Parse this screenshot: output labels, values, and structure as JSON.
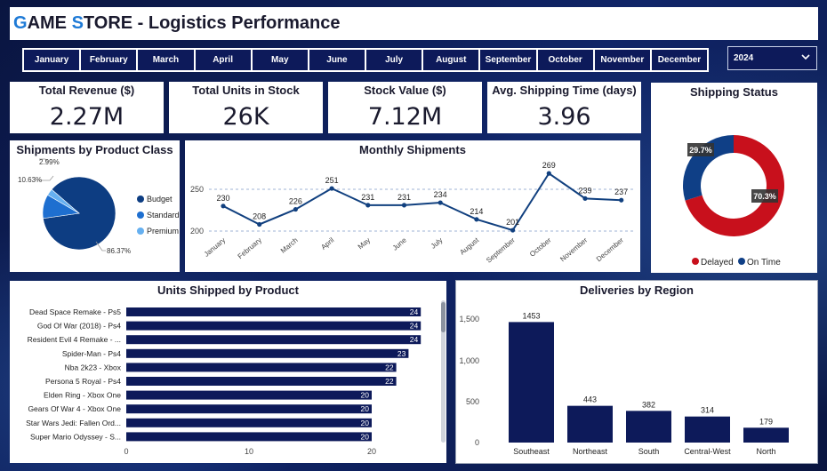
{
  "header": {
    "title_g": "G",
    "title_ame": "AME ",
    "title_s": "S",
    "title_rest": "TORE - Logistics Performance"
  },
  "months": [
    "January",
    "February",
    "March",
    "April",
    "May",
    "June",
    "July",
    "August",
    "September",
    "October",
    "November",
    "December"
  ],
  "year_select": {
    "selected": "2024"
  },
  "kpis": [
    {
      "title": "Total Revenue ($)",
      "value": "2.27M"
    },
    {
      "title": "Total Units in Stock",
      "value": "26K"
    },
    {
      "title": "Stock Value ($)",
      "value": "7.12M"
    },
    {
      "title": "Avg. Shipping Time (days)",
      "value": "3.96"
    }
  ],
  "colors": {
    "navy": "#0d1a5a",
    "budget": "#0d3d82",
    "standard": "#1e6fd0",
    "premium": "#66b0f0",
    "delayed": "#c8101c",
    "ontime": "#0f3f86",
    "accent": "#1e7ad6"
  },
  "chart_data": [
    {
      "id": "product_class",
      "type": "pie",
      "title": "Shipments by Product Class",
      "labels": [
        "Budget",
        "Standard",
        "Premium"
      ],
      "values": [
        86.37,
        10.63,
        2.99
      ],
      "value_labels": [
        "86.37%",
        "10.63%",
        "2.99%"
      ],
      "legend": "right"
    },
    {
      "id": "monthly",
      "type": "line",
      "title": "Monthly Shipments",
      "categories": [
        "January",
        "February",
        "March",
        "April",
        "May",
        "June",
        "July",
        "August",
        "September",
        "October",
        "November",
        "December"
      ],
      "values": [
        230,
        208,
        226,
        251,
        231,
        231,
        234,
        214,
        201,
        269,
        239,
        237
      ],
      "yticks": [
        200,
        250
      ],
      "ylim": [
        190,
        280
      ],
      "grid": true
    },
    {
      "id": "shipping_status",
      "type": "pie",
      "title": "Shipping Status",
      "labels": [
        "Delayed",
        "On Time"
      ],
      "values": [
        70.3,
        29.7
      ],
      "value_labels": [
        "70.3%",
        "29.7%"
      ],
      "legend": "bottom"
    },
    {
      "id": "units_by_product",
      "type": "bar",
      "orientation": "horizontal",
      "title": "Units Shipped by Product",
      "categories": [
        "Dead Space Remake - Ps5",
        "God Of War (2018) - Ps4",
        "Resident Evil 4 Remake - ...",
        "Spider-Man - Ps4",
        "Nba 2k23 - Xbox",
        "Persona 5 Royal - Ps4",
        "Elden Ring - Xbox One",
        "Gears Of War 4 - Xbox One",
        "Star Wars Jedi: Fallen Ord...",
        "Super Mario Odyssey - S..."
      ],
      "values": [
        24,
        24,
        24,
        23,
        22,
        22,
        20,
        20,
        20,
        20
      ],
      "xticks": [
        0,
        10,
        20
      ],
      "xlim": [
        0,
        26
      ]
    },
    {
      "id": "deliveries_by_region",
      "type": "bar",
      "title": "Deliveries by Region",
      "categories": [
        "Southeast",
        "Northeast",
        "South",
        "Central-West",
        "North"
      ],
      "values": [
        1453,
        443,
        382,
        314,
        179
      ],
      "yticks": [
        0,
        500,
        1000,
        1500
      ],
      "ytick_labels": [
        "0",
        "500",
        "1,000",
        "1,500"
      ],
      "ylim": [
        0,
        1600
      ]
    }
  ]
}
